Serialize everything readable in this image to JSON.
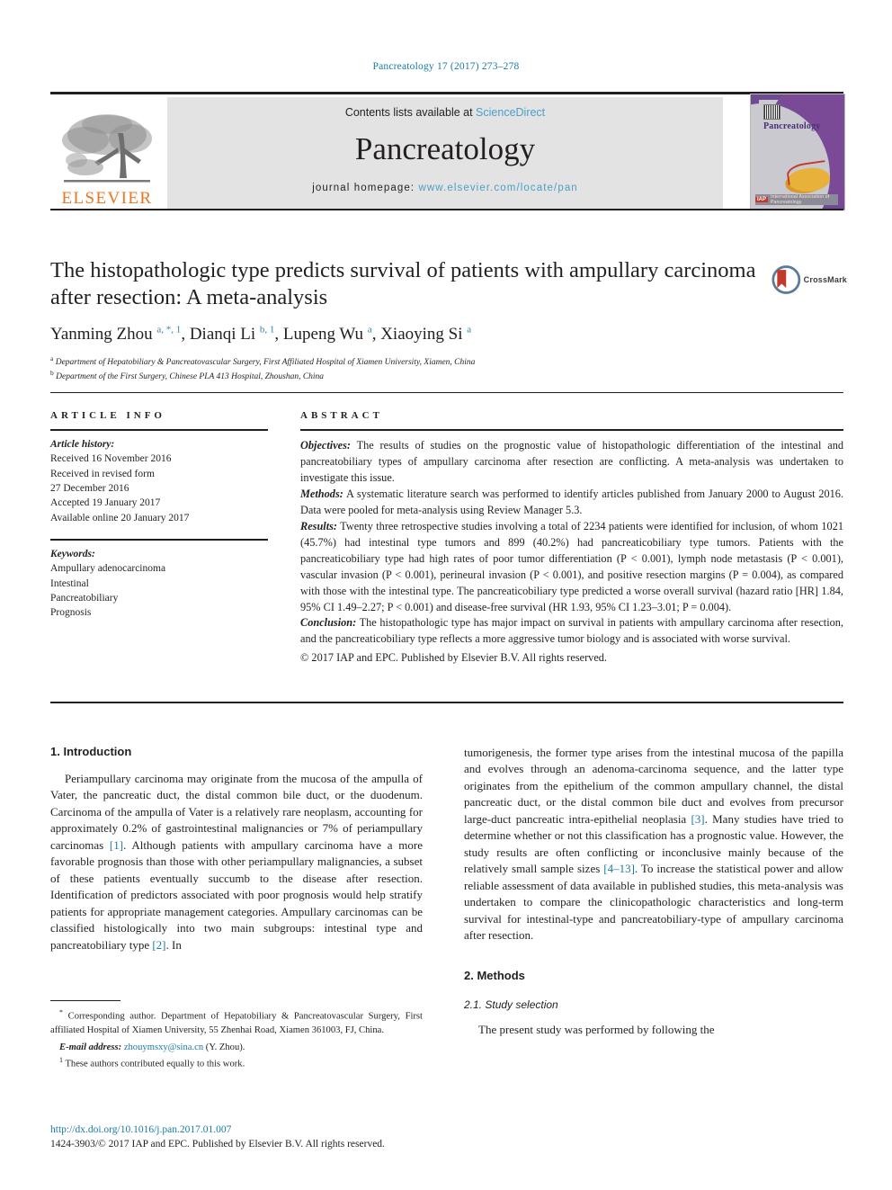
{
  "running_head": "Pancreatology 17 (2017) 273–278",
  "masthead": {
    "contents_prefix": "Contents lists available at ",
    "sciencedirect": "ScienceDirect",
    "journal_name": "Pancreatology",
    "homepage_prefix": "journal homepage: ",
    "homepage_url": "www.elsevier.com/locate/pan",
    "publisher_word": "ELSEVIER",
    "cover_title": "Pancreatology",
    "cover_footer_left": "IAP",
    "cover_footer_right": "International Association of Pancreatology",
    "link_color": "#4a9fc7"
  },
  "title_block": {
    "title": "The histopathologic type predicts survival of patients with ampullary carcinoma after resection: A meta-analysis",
    "authors_html": "Yanming Zhou <sup>a, *, 1</sup>, Dianqi Li <sup>b, 1</sup>, Lupeng Wu <sup>a</sup>, Xiaoying Si <sup>a</sup>",
    "affiliation_a": "Department of Hepatobiliary & Pancreatovascular Surgery, First Affiliated Hospital of Xiamen University, Xiamen, China",
    "affiliation_b": "Department of the First Surgery, Chinese PLA 413 Hospital, Zhoushan, China",
    "crossmark_label": "CrossMark"
  },
  "article_info": {
    "heading": "ARTICLE INFO",
    "history_label": "Article history:",
    "history": [
      "Received 16 November 2016",
      "Received in revised form",
      "27 December 2016",
      "Accepted 19 January 2017",
      "Available online 20 January 2017"
    ],
    "keywords_label": "Keywords:",
    "keywords": [
      "Ampullary adenocarcinoma",
      "Intestinal",
      "Pancreatobiliary",
      "Prognosis"
    ]
  },
  "abstract": {
    "heading": "ABSTRACT",
    "objectives_label": "Objectives:",
    "objectives_text": " The results of studies on the prognostic value of histopathologic differentiation of the intestinal and pancreatobiliary types of ampullary carcinoma after resection are conflicting. A meta-analysis was undertaken to investigate this issue.",
    "methods_label": "Methods:",
    "methods_text": " A systematic literature search was performed to identify articles published from January 2000 to August 2016. Data were pooled for meta-analysis using Review Manager 5.3.",
    "results_label": "Results:",
    "results_text": " Twenty three retrospective studies involving a total of 2234 patients were identified for inclusion, of whom 1021 (45.7%) had intestinal type tumors and 899 (40.2%) had pancreaticobiliary type tumors. Patients with the pancreaticobiliary type had high rates of poor tumor differentiation (P < 0.001), lymph node metastasis (P < 0.001), vascular invasion (P < 0.001), perineural invasion (P < 0.001), and positive resection margins (P = 0.004), as compared with those with the intestinal type. The pancreaticobiliary type predicted a worse overall survival (hazard ratio [HR] 1.84, 95% CI 1.49–2.27; P < 0.001) and disease-free survival (HR 1.93, 95% CI 1.23–3.01; P = 0.004).",
    "conclusion_label": "Conclusion:",
    "conclusion_text": " The histopathologic type has major impact on survival in patients with ampullary carcinoma after resection, and the pancreaticobiliary type reflects a more aggressive tumor biology and is associated with worse survival.",
    "copyright": "© 2017 IAP and EPC. Published by Elsevier B.V. All rights reserved."
  },
  "body": {
    "intro_heading": "1. Introduction",
    "intro_p1_a": "Periampullary carcinoma may originate from the mucosa of the ampulla of Vater, the pancreatic duct, the distal common bile duct, or the duodenum. Carcinoma of the ampulla of Vater is a relatively rare neoplasm, accounting for approximately 0.2% of gastrointestinal malignancies or 7% of periampullary carcinomas ",
    "intro_ref1": "[1]",
    "intro_p1_b": ". Although patients with ampullary carcinoma have a more favorable prognosis than those with other periampullary malignancies, a subset of these patients eventually succumb to the disease after resection. Identification of predictors associated with poor prognosis would help stratify patients for appropriate management categories. Ampullary carcinomas can be classified histologically into two main subgroups: intestinal type and pancreatobiliary type ",
    "intro_ref2": "[2]",
    "intro_p1_c": ". In",
    "intro_p2_a": "tumorigenesis, the former type arises from the intestinal mucosa of the papilla and evolves through an adenoma-carcinoma sequence, and the latter type originates from the epithelium of the common ampullary channel, the distal pancreatic duct, or the distal common bile duct and evolves from precursor large-duct pancreatic intra-epithelial neoplasia ",
    "intro_ref3": "[3]",
    "intro_p2_b": ". Many studies have tried to determine whether or not this classification has a prognostic value. However, the study results are often conflicting or inconclusive mainly because of the relatively small sample sizes ",
    "intro_ref4": "[4–13]",
    "intro_p2_c": ". To increase the statistical power and allow reliable assessment of data available in published studies, this meta-analysis was undertaken to compare the clinicopathologic characteristics and long-term survival for intestinal-type and pancreatobiliary-type of ampullary carcinoma after resection.",
    "methods_heading": "2. Methods",
    "study_selection_heading": "2.1. Study selection",
    "methods_p1": "The present study was performed by following the"
  },
  "footnotes": {
    "corresponding_mark": "*",
    "corresponding_text": " Corresponding author. Department of Hepatobiliary & Pancreatovascular Surgery, First affiliated Hospital of Xiamen University, 55 Zhenhai Road, Xiamen 361003, FJ, China.",
    "email_label": "E-mail address:",
    "email": "zhouymsxy@sina.cn",
    "email_suffix": " (Y. Zhou).",
    "equal_mark": "1",
    "equal_text": " These authors contributed equally to this work."
  },
  "footer": {
    "doi": "http://dx.doi.org/10.1016/j.pan.2017.01.007",
    "issn_line": "1424-3903/© 2017 IAP and EPC. Published by Elsevier B.V. All rights reserved."
  }
}
